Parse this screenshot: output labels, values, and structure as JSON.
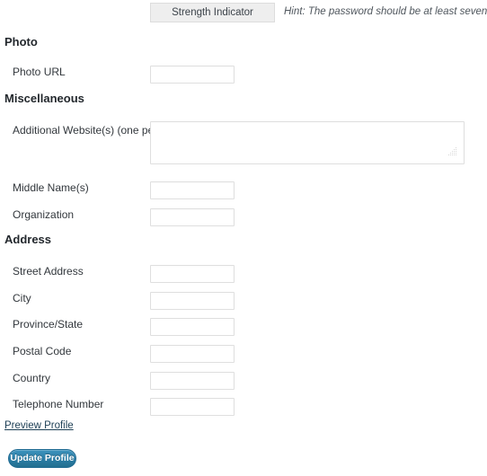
{
  "password": {
    "strength_indicator_label": "Strength Indicator",
    "hint": "Hint: The password should be at least seven characters long"
  },
  "sections": {
    "photo": {
      "heading": "Photo",
      "fields": [
        {
          "label": "Photo URL",
          "value": ""
        }
      ]
    },
    "miscellaneous": {
      "heading": "Miscellaneous",
      "websites": {
        "label_line1": "Additional Website(s)",
        "label_line2": "(one per line)",
        "value": ""
      },
      "fields": [
        {
          "label": "Middle Name(s)",
          "value": ""
        },
        {
          "label": "Organization",
          "value": ""
        }
      ]
    },
    "address": {
      "heading": "Address",
      "fields": [
        {
          "label": "Street Address",
          "value": ""
        },
        {
          "label": "City",
          "value": ""
        },
        {
          "label": "Province/State",
          "value": ""
        },
        {
          "label": "Postal Code",
          "value": ""
        },
        {
          "label": "Country",
          "value": ""
        },
        {
          "label": "Telephone Number",
          "value": ""
        }
      ]
    }
  },
  "actions": {
    "preview_profile_label": "Preview Profile",
    "update_profile_label": "Update Profile"
  },
  "colors": {
    "accent_button": "#2a7ca5",
    "accent_button_border": "#1f6a92",
    "link": "#1d3f55",
    "input_border": "#dfdfdf",
    "strength_bg": "#eeeeee",
    "text": "#32373c",
    "hint_text": "#50575e"
  }
}
